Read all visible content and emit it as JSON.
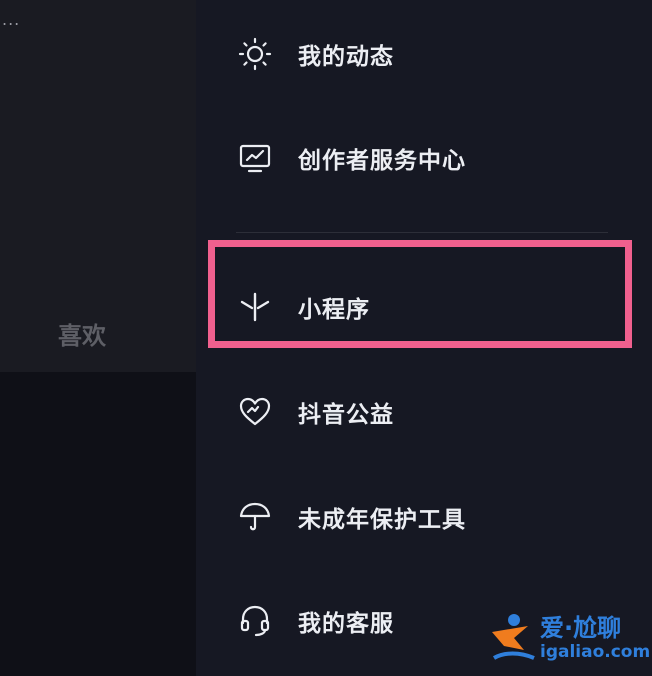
{
  "background_page": {
    "more_symbol": "...",
    "like_tab_label": "喜欢"
  },
  "menu": {
    "items": [
      {
        "label": "我的动态",
        "icon": "sun-icon"
      },
      {
        "label": "创作者服务中心",
        "icon": "monitor-chart-icon"
      },
      {
        "label": "小程序",
        "icon": "mini-program-icon"
      },
      {
        "label": "抖音公益",
        "icon": "heart-charity-icon"
      },
      {
        "label": "未成年保护工具",
        "icon": "umbrella-icon"
      },
      {
        "label": "我的客服",
        "icon": "headset-icon"
      }
    ],
    "highlighted_item": "小程序"
  },
  "watermark": {
    "line1": "爱·尬聊",
    "line2": "igaliao.com"
  },
  "colors": {
    "drawer_bg": "#161823",
    "text": "#eceef3",
    "highlight": "#f0608e",
    "watermark_blue": "#2f7fdc",
    "watermark_orange": "#f07c1e"
  }
}
